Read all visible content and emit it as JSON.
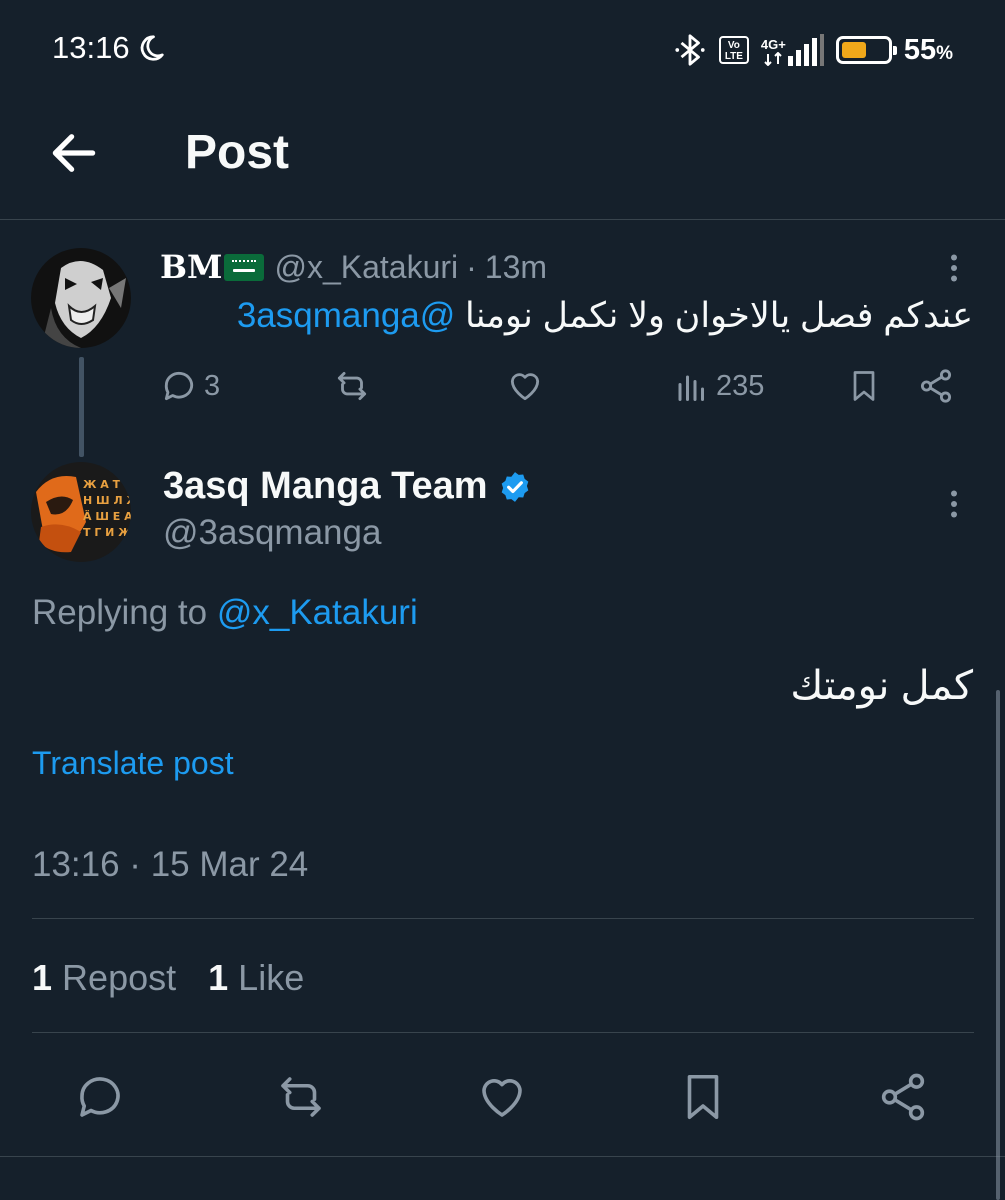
{
  "status_bar": {
    "time": "13:16",
    "network_volte": "Vo LTE",
    "network_type": "4G+",
    "battery_percent": "55",
    "battery_percent_sign": "%",
    "battery_level": 0.55,
    "icons": [
      "moon-icon",
      "bluetooth-icon",
      "volte-icon",
      "signal-icon",
      "battery-icon"
    ]
  },
  "header": {
    "title": "Post"
  },
  "parent_post": {
    "display_name": "BM",
    "handle": "@x_Katakuri",
    "separator": "·",
    "time_ago": "13m",
    "text_mention": "@3asqmanga",
    "text_body": "عندكم فصل يالاخوان ولا نكمل نومنا",
    "reply_count": "3",
    "view_count": "235"
  },
  "main_post": {
    "display_name": "3asq Manga Team",
    "handle": "@3asqmanga",
    "replying_prefix": "Replying to",
    "replying_handle": "@x_Katakuri",
    "text": "كمل نومتك",
    "translate_label": "Translate post",
    "timestamp": "13:16 · 15 Mar 24",
    "repost_count": "1",
    "repost_label": "Repost",
    "like_count": "1",
    "like_label": "Like"
  },
  "colors": {
    "background": "#15202b",
    "link": "#1d9bf0",
    "muted": "#8b98a5",
    "divider": "#38444d",
    "verified": "#1d9bf0"
  }
}
